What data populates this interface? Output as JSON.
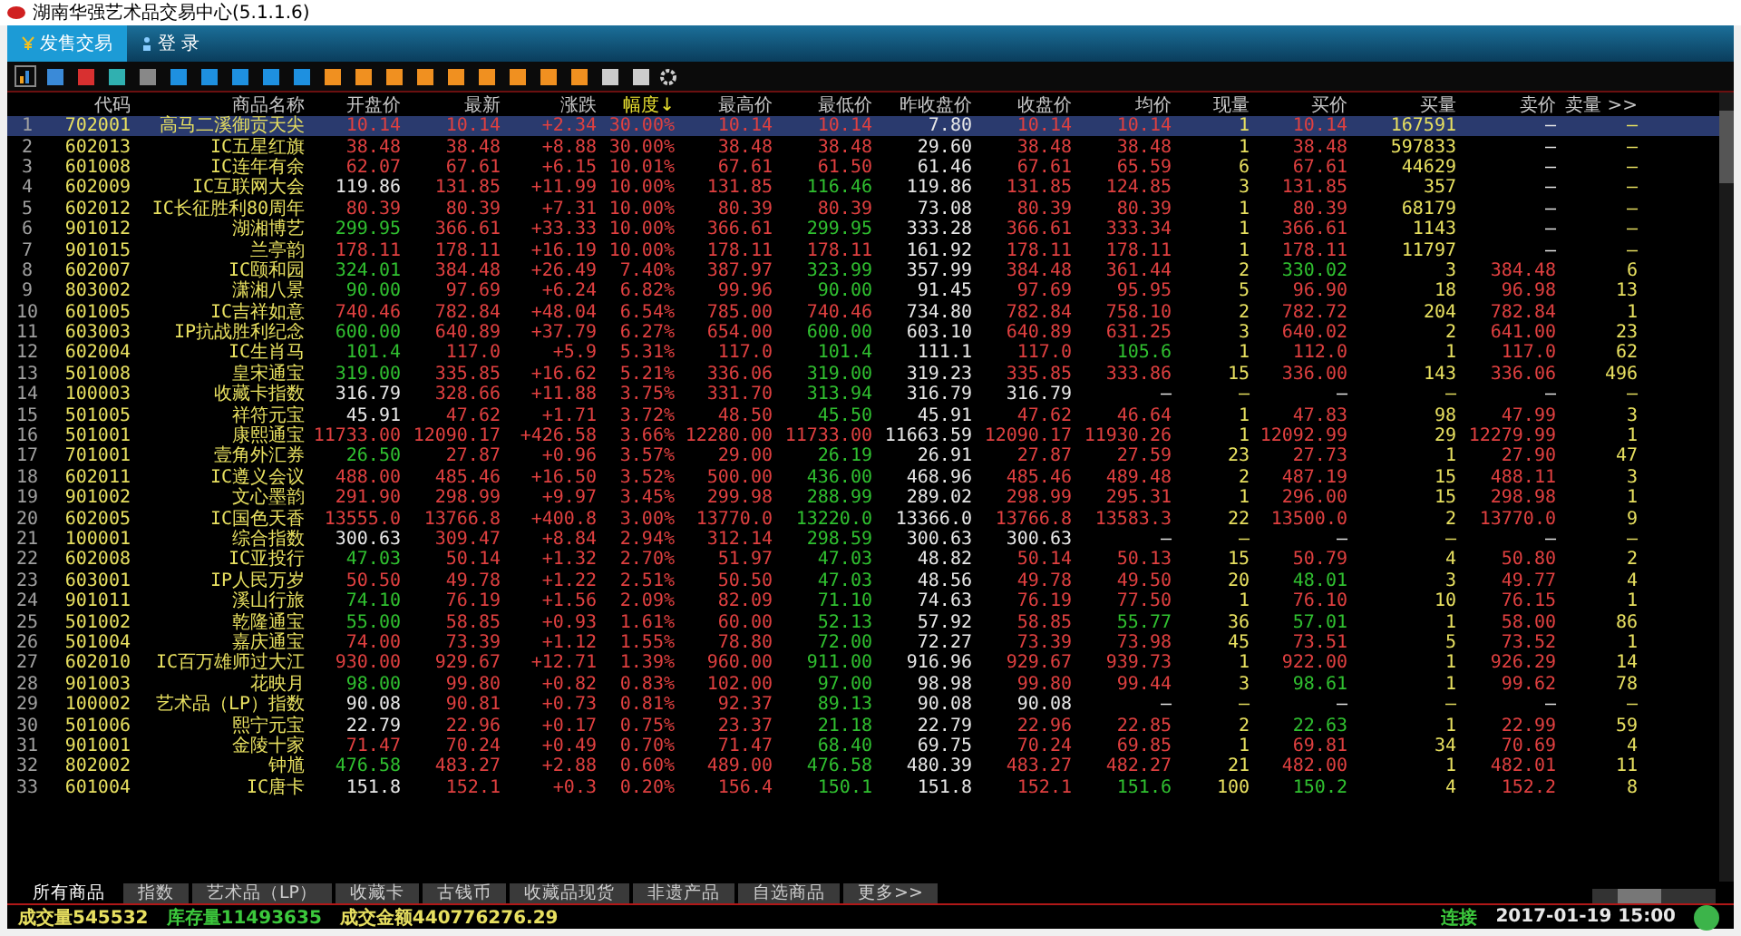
{
  "window": {
    "title": "湖南华强艺术品交易中心(5.1.1.6)"
  },
  "menu": [
    {
      "label": "发售交易",
      "selected": true
    },
    {
      "label": "登 录",
      "selected": false
    }
  ],
  "table": {
    "columns": [
      {
        "label": "代码",
        "sorted": false
      },
      {
        "label": "商品名称",
        "sorted": false
      },
      {
        "label": "开盘价",
        "sorted": false
      },
      {
        "label": "最新",
        "sorted": false
      },
      {
        "label": "涨跌",
        "sorted": false
      },
      {
        "label": "幅度↓",
        "sorted": true
      },
      {
        "label": "最高价",
        "sorted": false
      },
      {
        "label": "最低价",
        "sorted": false
      },
      {
        "label": "昨收盘价",
        "sorted": false
      },
      {
        "label": "收盘价",
        "sorted": false
      },
      {
        "label": "均价",
        "sorted": false
      },
      {
        "label": "现量",
        "sorted": false
      },
      {
        "label": "买价",
        "sorted": false
      },
      {
        "label": "买量",
        "sorted": false
      },
      {
        "label": "卖价",
        "sorted": false
      },
      {
        "label": "卖量 >>",
        "sorted": false
      }
    ],
    "rows": [
      {
        "number": "1",
        "selected": true,
        "cells": [
          "702001",
          "高马二溪御贡天尖",
          "10.14",
          "10.14",
          "+2.34",
          "30.00%",
          "10.14",
          "10.14",
          "7.80",
          "10.14",
          "10.14",
          "1",
          "10.14",
          "167591",
          "—",
          "—"
        ]
      },
      {
        "number": "2",
        "selected": false,
        "cells": [
          "602013",
          "IC五星红旗",
          "38.48",
          "38.48",
          "+8.88",
          "30.00%",
          "38.48",
          "38.48",
          "29.60",
          "38.48",
          "38.48",
          "1",
          "38.48",
          "597833",
          "—",
          "—"
        ]
      },
      {
        "number": "3",
        "selected": false,
        "cells": [
          "601008",
          "IC连年有余",
          "62.07",
          "67.61",
          "+6.15",
          "10.01%",
          "67.61",
          "61.50",
          "61.46",
          "67.61",
          "65.59",
          "6",
          "67.61",
          "44629",
          "—",
          "—"
        ]
      },
      {
        "number": "4",
        "selected": false,
        "cells": [
          "602009",
          "IC互联网大会",
          "119.86",
          "131.85",
          "+11.99",
          "10.00%",
          "131.85",
          "116.46",
          "119.86",
          "131.85",
          "124.85",
          "3",
          "131.85",
          "357",
          "—",
          "—"
        ]
      },
      {
        "number": "5",
        "selected": false,
        "cells": [
          "602012",
          "IC长征胜利80周年",
          "80.39",
          "80.39",
          "+7.31",
          "10.00%",
          "80.39",
          "80.39",
          "73.08",
          "80.39",
          "80.39",
          "1",
          "80.39",
          "68179",
          "—",
          "—"
        ]
      },
      {
        "number": "6",
        "selected": false,
        "cells": [
          "901012",
          "湖湘博艺",
          "299.95",
          "366.61",
          "+33.33",
          "10.00%",
          "366.61",
          "299.95",
          "333.28",
          "366.61",
          "333.34",
          "1",
          "366.61",
          "1143",
          "—",
          "—"
        ]
      },
      {
        "number": "7",
        "selected": false,
        "cells": [
          "901015",
          "兰亭韵",
          "178.11",
          "178.11",
          "+16.19",
          "10.00%",
          "178.11",
          "178.11",
          "161.92",
          "178.11",
          "178.11",
          "1",
          "178.11",
          "11797",
          "—",
          "—"
        ]
      },
      {
        "number": "8",
        "selected": false,
        "cells": [
          "602007",
          "IC颐和园",
          "324.01",
          "384.48",
          "+26.49",
          "7.40%",
          "387.97",
          "323.99",
          "357.99",
          "384.48",
          "361.44",
          "2",
          "330.02",
          "3",
          "384.48",
          "6"
        ]
      },
      {
        "number": "9",
        "selected": false,
        "cells": [
          "803002",
          "潇湘八景",
          "90.00",
          "97.69",
          "+6.24",
          "6.82%",
          "99.96",
          "90.00",
          "91.45",
          "97.69",
          "95.95",
          "5",
          "96.90",
          "18",
          "96.98",
          "13"
        ]
      },
      {
        "number": "10",
        "selected": false,
        "cells": [
          "601005",
          "IC吉祥如意",
          "740.46",
          "782.84",
          "+48.04",
          "6.54%",
          "785.00",
          "740.46",
          "734.80",
          "782.84",
          "758.10",
          "2",
          "782.72",
          "204",
          "782.84",
          "1"
        ]
      },
      {
        "number": "11",
        "selected": false,
        "cells": [
          "603003",
          "IP抗战胜利纪念",
          "600.00",
          "640.89",
          "+37.79",
          "6.27%",
          "654.00",
          "600.00",
          "603.10",
          "640.89",
          "631.25",
          "3",
          "640.02",
          "2",
          "641.00",
          "23"
        ]
      },
      {
        "number": "12",
        "selected": false,
        "cells": [
          "602004",
          "IC生肖马",
          "101.4",
          "117.0",
          "+5.9",
          "5.31%",
          "117.0",
          "101.4",
          "111.1",
          "117.0",
          "105.6",
          "1",
          "112.0",
          "1",
          "117.0",
          "62"
        ]
      },
      {
        "number": "13",
        "selected": false,
        "cells": [
          "501008",
          "皇宋通宝",
          "319.00",
          "335.85",
          "+16.62",
          "5.21%",
          "336.06",
          "319.00",
          "319.23",
          "335.85",
          "333.86",
          "15",
          "336.00",
          "143",
          "336.06",
          "496"
        ]
      },
      {
        "number": "14",
        "selected": false,
        "cells": [
          "100003",
          "收藏卡指数",
          "316.79",
          "328.66",
          "+11.88",
          "3.75%",
          "331.70",
          "313.94",
          "316.79",
          "316.79",
          "—",
          "—",
          "—",
          "—",
          "—",
          "—"
        ]
      },
      {
        "number": "15",
        "selected": false,
        "cells": [
          "501005",
          "祥符元宝",
          "45.91",
          "47.62",
          "+1.71",
          "3.72%",
          "48.50",
          "45.50",
          "45.91",
          "47.62",
          "46.64",
          "1",
          "47.83",
          "98",
          "47.99",
          "3"
        ]
      },
      {
        "number": "16",
        "selected": false,
        "cells": [
          "501001",
          "康熙通宝",
          "11733.00",
          "12090.17",
          "+426.58",
          "3.66%",
          "12280.00",
          "11733.00",
          "11663.59",
          "12090.17",
          "11930.26",
          "1",
          "12092.99",
          "29",
          "12279.99",
          "1"
        ]
      },
      {
        "number": "17",
        "selected": false,
        "cells": [
          "701001",
          "壹角外汇券",
          "26.50",
          "27.87",
          "+0.96",
          "3.57%",
          "29.00",
          "26.19",
          "26.91",
          "27.87",
          "27.59",
          "23",
          "27.73",
          "1",
          "27.90",
          "47"
        ]
      },
      {
        "number": "18",
        "selected": false,
        "cells": [
          "602011",
          "IC遵义会议",
          "488.00",
          "485.46",
          "+16.50",
          "3.52%",
          "500.00",
          "436.00",
          "468.96",
          "485.46",
          "489.48",
          "2",
          "487.19",
          "15",
          "488.11",
          "3"
        ]
      },
      {
        "number": "19",
        "selected": false,
        "cells": [
          "901002",
          "文心墨韵",
          "291.90",
          "298.99",
          "+9.97",
          "3.45%",
          "299.98",
          "288.99",
          "289.02",
          "298.99",
          "295.31",
          "1",
          "296.00",
          "15",
          "298.98",
          "1"
        ]
      },
      {
        "number": "20",
        "selected": false,
        "cells": [
          "602005",
          "IC国色天香",
          "13555.0",
          "13766.8",
          "+400.8",
          "3.00%",
          "13770.0",
          "13220.0",
          "13366.0",
          "13766.8",
          "13583.3",
          "22",
          "13500.0",
          "2",
          "13770.0",
          "9"
        ]
      },
      {
        "number": "21",
        "selected": false,
        "cells": [
          "100001",
          "综合指数",
          "300.63",
          "309.47",
          "+8.84",
          "2.94%",
          "312.14",
          "298.59",
          "300.63",
          "300.63",
          "—",
          "—",
          "—",
          "—",
          "—",
          "—"
        ]
      },
      {
        "number": "22",
        "selected": false,
        "cells": [
          "602008",
          "IC亚投行",
          "47.03",
          "50.14",
          "+1.32",
          "2.70%",
          "51.97",
          "47.03",
          "48.82",
          "50.14",
          "50.13",
          "15",
          "50.79",
          "4",
          "50.80",
          "2"
        ]
      },
      {
        "number": "23",
        "selected": false,
        "cells": [
          "603001",
          "IP人民万岁",
          "50.50",
          "49.78",
          "+1.22",
          "2.51%",
          "50.50",
          "47.03",
          "48.56",
          "49.78",
          "49.50",
          "20",
          "48.01",
          "3",
          "49.77",
          "4"
        ]
      },
      {
        "number": "24",
        "selected": false,
        "cells": [
          "901011",
          "溪山行旅",
          "74.10",
          "76.19",
          "+1.56",
          "2.09%",
          "82.09",
          "71.10",
          "74.63",
          "76.19",
          "77.50",
          "1",
          "76.10",
          "10",
          "76.15",
          "1"
        ]
      },
      {
        "number": "25",
        "selected": false,
        "cells": [
          "501002",
          "乾隆通宝",
          "55.00",
          "58.85",
          "+0.93",
          "1.61%",
          "60.00",
          "52.13",
          "57.92",
          "58.85",
          "55.77",
          "36",
          "57.01",
          "1",
          "58.00",
          "86"
        ]
      },
      {
        "number": "26",
        "selected": false,
        "cells": [
          "501004",
          "嘉庆通宝",
          "74.00",
          "73.39",
          "+1.12",
          "1.55%",
          "78.80",
          "72.00",
          "72.27",
          "73.39",
          "73.98",
          "45",
          "73.51",
          "5",
          "73.52",
          "1"
        ]
      },
      {
        "number": "27",
        "selected": false,
        "cells": [
          "602010",
          "IC百万雄师过大江",
          "930.00",
          "929.67",
          "+12.71",
          "1.39%",
          "960.00",
          "911.00",
          "916.96",
          "929.67",
          "939.73",
          "1",
          "922.00",
          "1",
          "926.29",
          "14"
        ]
      },
      {
        "number": "28",
        "selected": false,
        "cells": [
          "901003",
          "花映月",
          "98.00",
          "99.80",
          "+0.82",
          "0.83%",
          "102.00",
          "97.00",
          "98.98",
          "99.80",
          "99.44",
          "3",
          "98.61",
          "1",
          "99.62",
          "78"
        ]
      },
      {
        "number": "29",
        "selected": false,
        "cells": [
          "100002",
          "艺术品（LP）指数",
          "90.08",
          "90.81",
          "+0.73",
          "0.81%",
          "92.37",
          "89.13",
          "90.08",
          "90.08",
          "—",
          "—",
          "—",
          "—",
          "—",
          "—"
        ]
      },
      {
        "number": "30",
        "selected": false,
        "cells": [
          "501006",
          "熙宁元宝",
          "22.79",
          "22.96",
          "+0.17",
          "0.75%",
          "23.37",
          "21.18",
          "22.79",
          "22.96",
          "22.85",
          "2",
          "22.63",
          "1",
          "22.99",
          "59"
        ]
      },
      {
        "number": "31",
        "selected": false,
        "cells": [
          "901001",
          "金陵十家",
          "71.47",
          "70.24",
          "+0.49",
          "0.70%",
          "71.47",
          "68.40",
          "69.75",
          "70.24",
          "69.85",
          "1",
          "69.81",
          "34",
          "70.69",
          "4"
        ]
      },
      {
        "number": "32",
        "selected": false,
        "cells": [
          "802002",
          "钟馗",
          "476.58",
          "483.27",
          "+2.88",
          "0.60%",
          "489.00",
          "476.58",
          "480.39",
          "483.27",
          "482.27",
          "21",
          "482.00",
          "1",
          "482.01",
          "11"
        ]
      },
      {
        "number": "33",
        "selected": false,
        "cells": [
          "601004",
          "IC唐卡",
          "151.8",
          "152.1",
          "+0.3",
          "0.20%",
          "156.4",
          "150.1",
          "151.8",
          "152.1",
          "151.6",
          "100",
          "150.2",
          "4",
          "152.2",
          "8"
        ]
      }
    ]
  },
  "category_tabs": [
    {
      "label": "所有商品",
      "selected": true
    },
    {
      "label": "指数",
      "selected": false
    },
    {
      "label": "艺术品（LP）",
      "selected": false
    },
    {
      "label": "收藏卡",
      "selected": false
    },
    {
      "label": "古钱币",
      "selected": false
    },
    {
      "label": "收藏品现货",
      "selected": false
    },
    {
      "label": "非遗产品",
      "selected": false
    },
    {
      "label": "自选商品",
      "selected": false
    },
    {
      "label": "更多>>",
      "selected": false
    }
  ],
  "status_bar": {
    "items": [
      {
        "text": "成交量545532",
        "kind": "volume"
      },
      {
        "text": "库存量11493635",
        "kind": "stock"
      },
      {
        "text": "成交金额440776276.29",
        "kind": "amount"
      }
    ],
    "connection": {
      "text": "连接",
      "color": "#3cc83c"
    },
    "time": "2017-01-19 15:00"
  }
}
